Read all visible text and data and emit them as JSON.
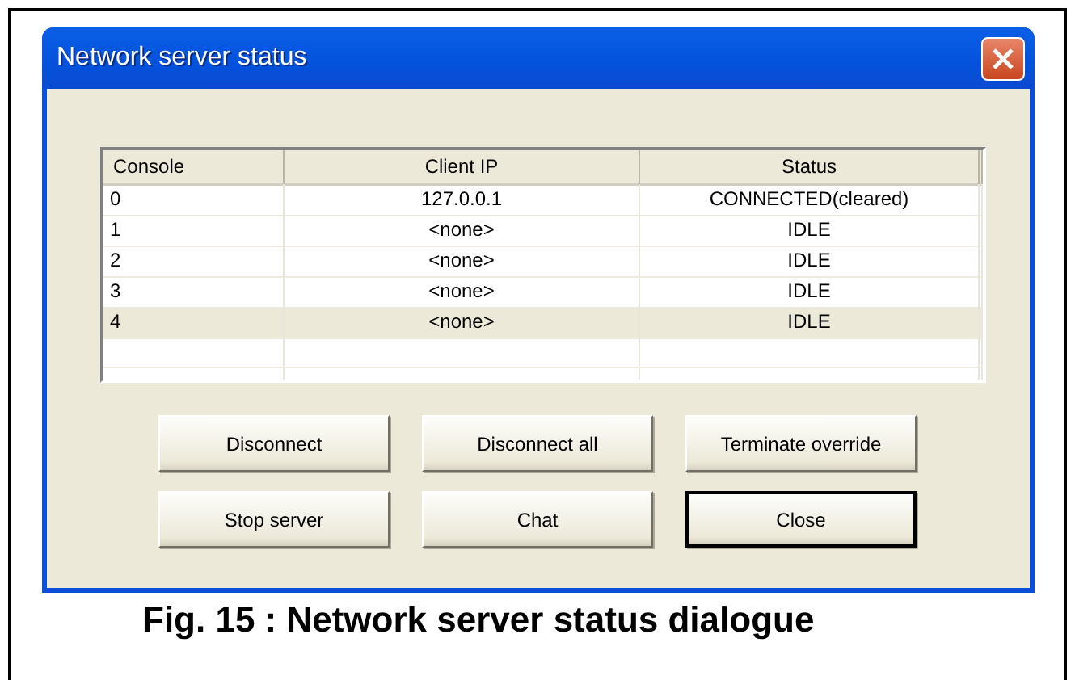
{
  "window": {
    "title": "Network server status"
  },
  "table": {
    "columns": [
      "Console",
      "Client IP",
      "Status"
    ],
    "rows": [
      {
        "cells": [
          "0",
          "127.0.0.1",
          "CONNECTED(cleared)"
        ],
        "selected": false
      },
      {
        "cells": [
          "1",
          "<none>",
          "IDLE"
        ],
        "selected": false
      },
      {
        "cells": [
          "2",
          "<none>",
          "IDLE"
        ],
        "selected": false
      },
      {
        "cells": [
          "3",
          "<none>",
          "IDLE"
        ],
        "selected": false
      },
      {
        "cells": [
          "4",
          "<none>",
          "IDLE"
        ],
        "selected": true
      }
    ]
  },
  "buttons": [
    {
      "label": "Disconnect",
      "default": false
    },
    {
      "label": "Disconnect all",
      "default": false
    },
    {
      "label": "Terminate override",
      "default": false
    },
    {
      "label": "Stop server",
      "default": false
    },
    {
      "label": "Chat",
      "default": false
    },
    {
      "label": "Close",
      "default": true
    }
  ],
  "caption": "Fig. 15 : Network server status dialogue"
}
